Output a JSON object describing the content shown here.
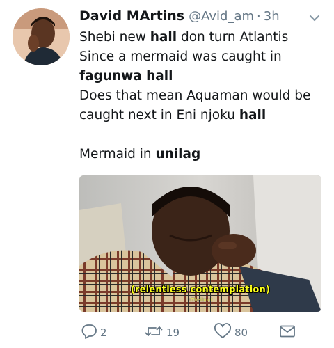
{
  "tweet": {
    "author": {
      "display_name": "David MArtins",
      "handle": "@Avid_am",
      "separator": "·",
      "time": "3h"
    },
    "lines": [
      [
        {
          "t": "Shebi new "
        },
        {
          "t": "hall",
          "b": true
        },
        {
          "t": " don turn Atlantis"
        }
      ],
      [
        {
          "t": "Since a mermaid was caught in"
        }
      ],
      [
        {
          "t": "fagunwa hall",
          "b": true
        }
      ],
      [
        {
          "t": "Does that mean Aquaman would be"
        }
      ],
      [
        {
          "t": "caught next in Eni njoku "
        },
        {
          "t": "hall",
          "b": true
        }
      ],
      [],
      [
        {
          "t": "Mermaid in "
        },
        {
          "t": "unilag",
          "b": true
        }
      ]
    ],
    "media": {
      "caption": "(relentless contemplation)",
      "watermark": "nTheIbnct"
    },
    "actions": {
      "reply_count": "2",
      "retweet_count": "19",
      "like_count": "80"
    },
    "icons": {
      "reply": "reply-icon",
      "retweet": "retweet-icon",
      "like": "heart-icon",
      "message": "envelope-icon",
      "menu": "chevron-down-icon"
    },
    "colors": {
      "text": "#14171a",
      "secondary": "#657786",
      "caption": "#fbff1a"
    }
  }
}
